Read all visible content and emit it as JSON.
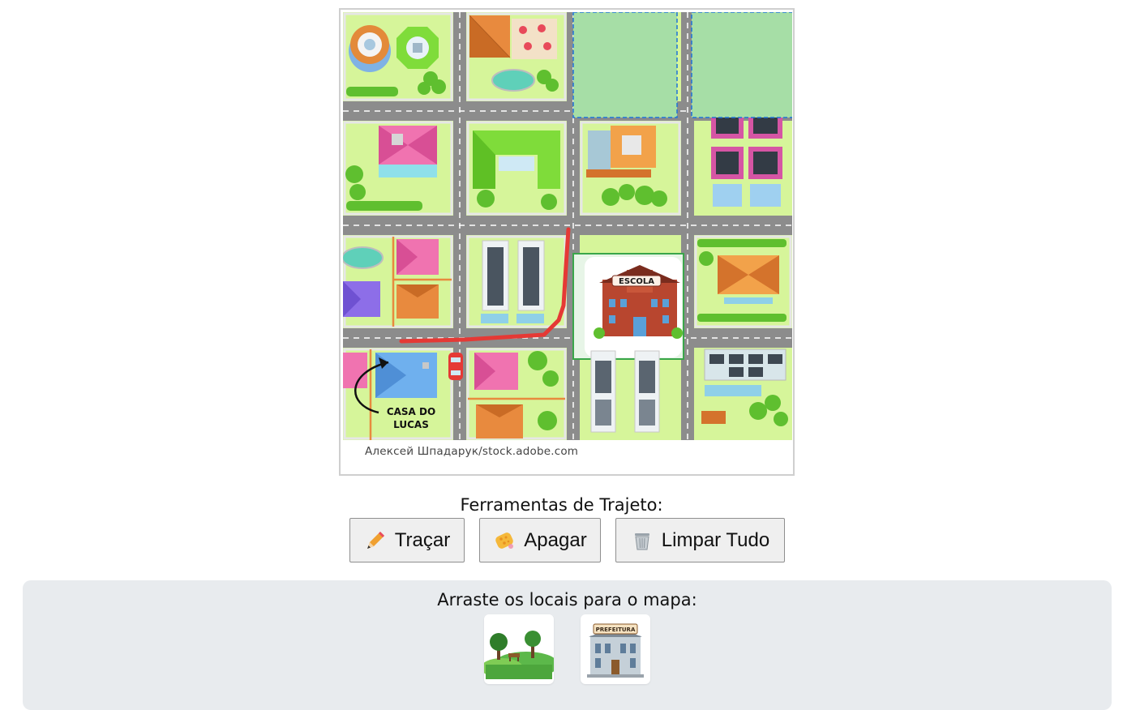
{
  "map": {
    "credit": "Алексей Шпадарук/stock.adobe.com",
    "school_label": "ESCOLA",
    "home_label_line1": "CASA DO",
    "home_label_line2": "LUCAS"
  },
  "tools": {
    "title": "Ferramentas de Trajeto:",
    "draw_label": "Traçar",
    "erase_label": "Apagar",
    "clear_label": "Limpar Tudo",
    "draw_icon": "pencil-icon",
    "erase_icon": "sponge-icon",
    "clear_icon": "trash-icon"
  },
  "palette": {
    "title": "Arraste os locais para o mapa:",
    "items": [
      {
        "name": "park",
        "icon": "park-icon"
      },
      {
        "name": "city-hall",
        "label": "PREFEITURA",
        "icon": "city-hall-icon"
      }
    ]
  },
  "colors": {
    "route": "#e53935",
    "drop_zone": "#1e73d8",
    "grass": "#d6f59a",
    "road": "#8c8c8c",
    "palette_bg": "#e8ebee"
  }
}
